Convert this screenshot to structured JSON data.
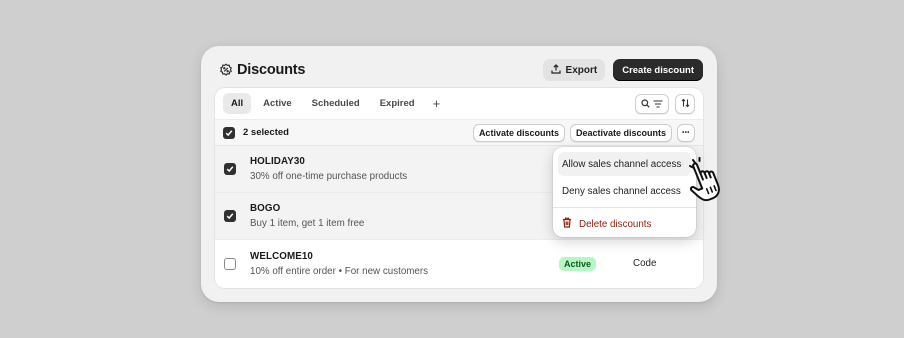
{
  "header": {
    "title": "Discounts",
    "export_label": "Export",
    "create_label": "Create discount"
  },
  "tabs": [
    {
      "label": "All",
      "active": true
    },
    {
      "label": "Active",
      "active": false
    },
    {
      "label": "Scheduled",
      "active": false
    },
    {
      "label": "Expired",
      "active": false
    }
  ],
  "add_tab_label": "+",
  "bulk": {
    "selected_label": "2 selected",
    "activate_label": "Activate discounts",
    "deactivate_label": "Deactivate discounts",
    "more_label": "•••"
  },
  "rows": [
    {
      "title": "HOLIDAY30",
      "subtitle": "30% off one-time purchase products",
      "checked": true
    },
    {
      "title": "BOGO",
      "subtitle": "Buy 1 item, get 1 item free",
      "checked": true
    },
    {
      "title": "WELCOME10",
      "subtitle": "10% off entire order • For new customers",
      "checked": false,
      "status": "Active",
      "method": "Code"
    }
  ],
  "menu": {
    "items": [
      {
        "label": "Allow sales channel access"
      },
      {
        "label": "Deny sales channel access"
      }
    ],
    "delete_label": "Delete discounts"
  },
  "colors": {
    "primary_button": "#2b2b2b",
    "active_badge_bg": "#b7f5c5",
    "danger": "#8e1f0b"
  }
}
